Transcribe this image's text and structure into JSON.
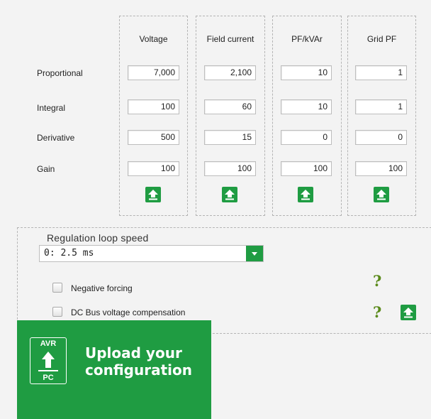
{
  "columns": [
    {
      "header": "Voltage",
      "values": [
        "7,000",
        "100",
        "500",
        "100"
      ]
    },
    {
      "header": "Field current",
      "values": [
        "2,100",
        "60",
        "15",
        "100"
      ]
    },
    {
      "header": "PF/kVAr",
      "values": [
        "10",
        "10",
        "0",
        "100"
      ]
    },
    {
      "header": "Grid PF",
      "values": [
        "1",
        "1",
        "0",
        "100"
      ]
    }
  ],
  "rows": [
    "Proportional",
    "Integral",
    "Derivative",
    "Gain"
  ],
  "regulation": {
    "label": "Regulation loop speed",
    "selected": "0: 2.5 ms"
  },
  "options": [
    {
      "label": "Negative forcing",
      "checked": false
    },
    {
      "label": "DC Bus voltage compensation",
      "checked": false
    }
  ],
  "upload": {
    "icon_top": "AVR",
    "icon_bottom": "PC",
    "line1": "Upload your",
    "line2": "configuration"
  },
  "icons": {
    "upload": "upload-arrow-icon",
    "help": "help-question-icon",
    "dropdown": "chevron-down-icon"
  },
  "colors": {
    "accent": "#1f9c42",
    "help": "#5a8a1a",
    "background": "#f3f3f3"
  }
}
